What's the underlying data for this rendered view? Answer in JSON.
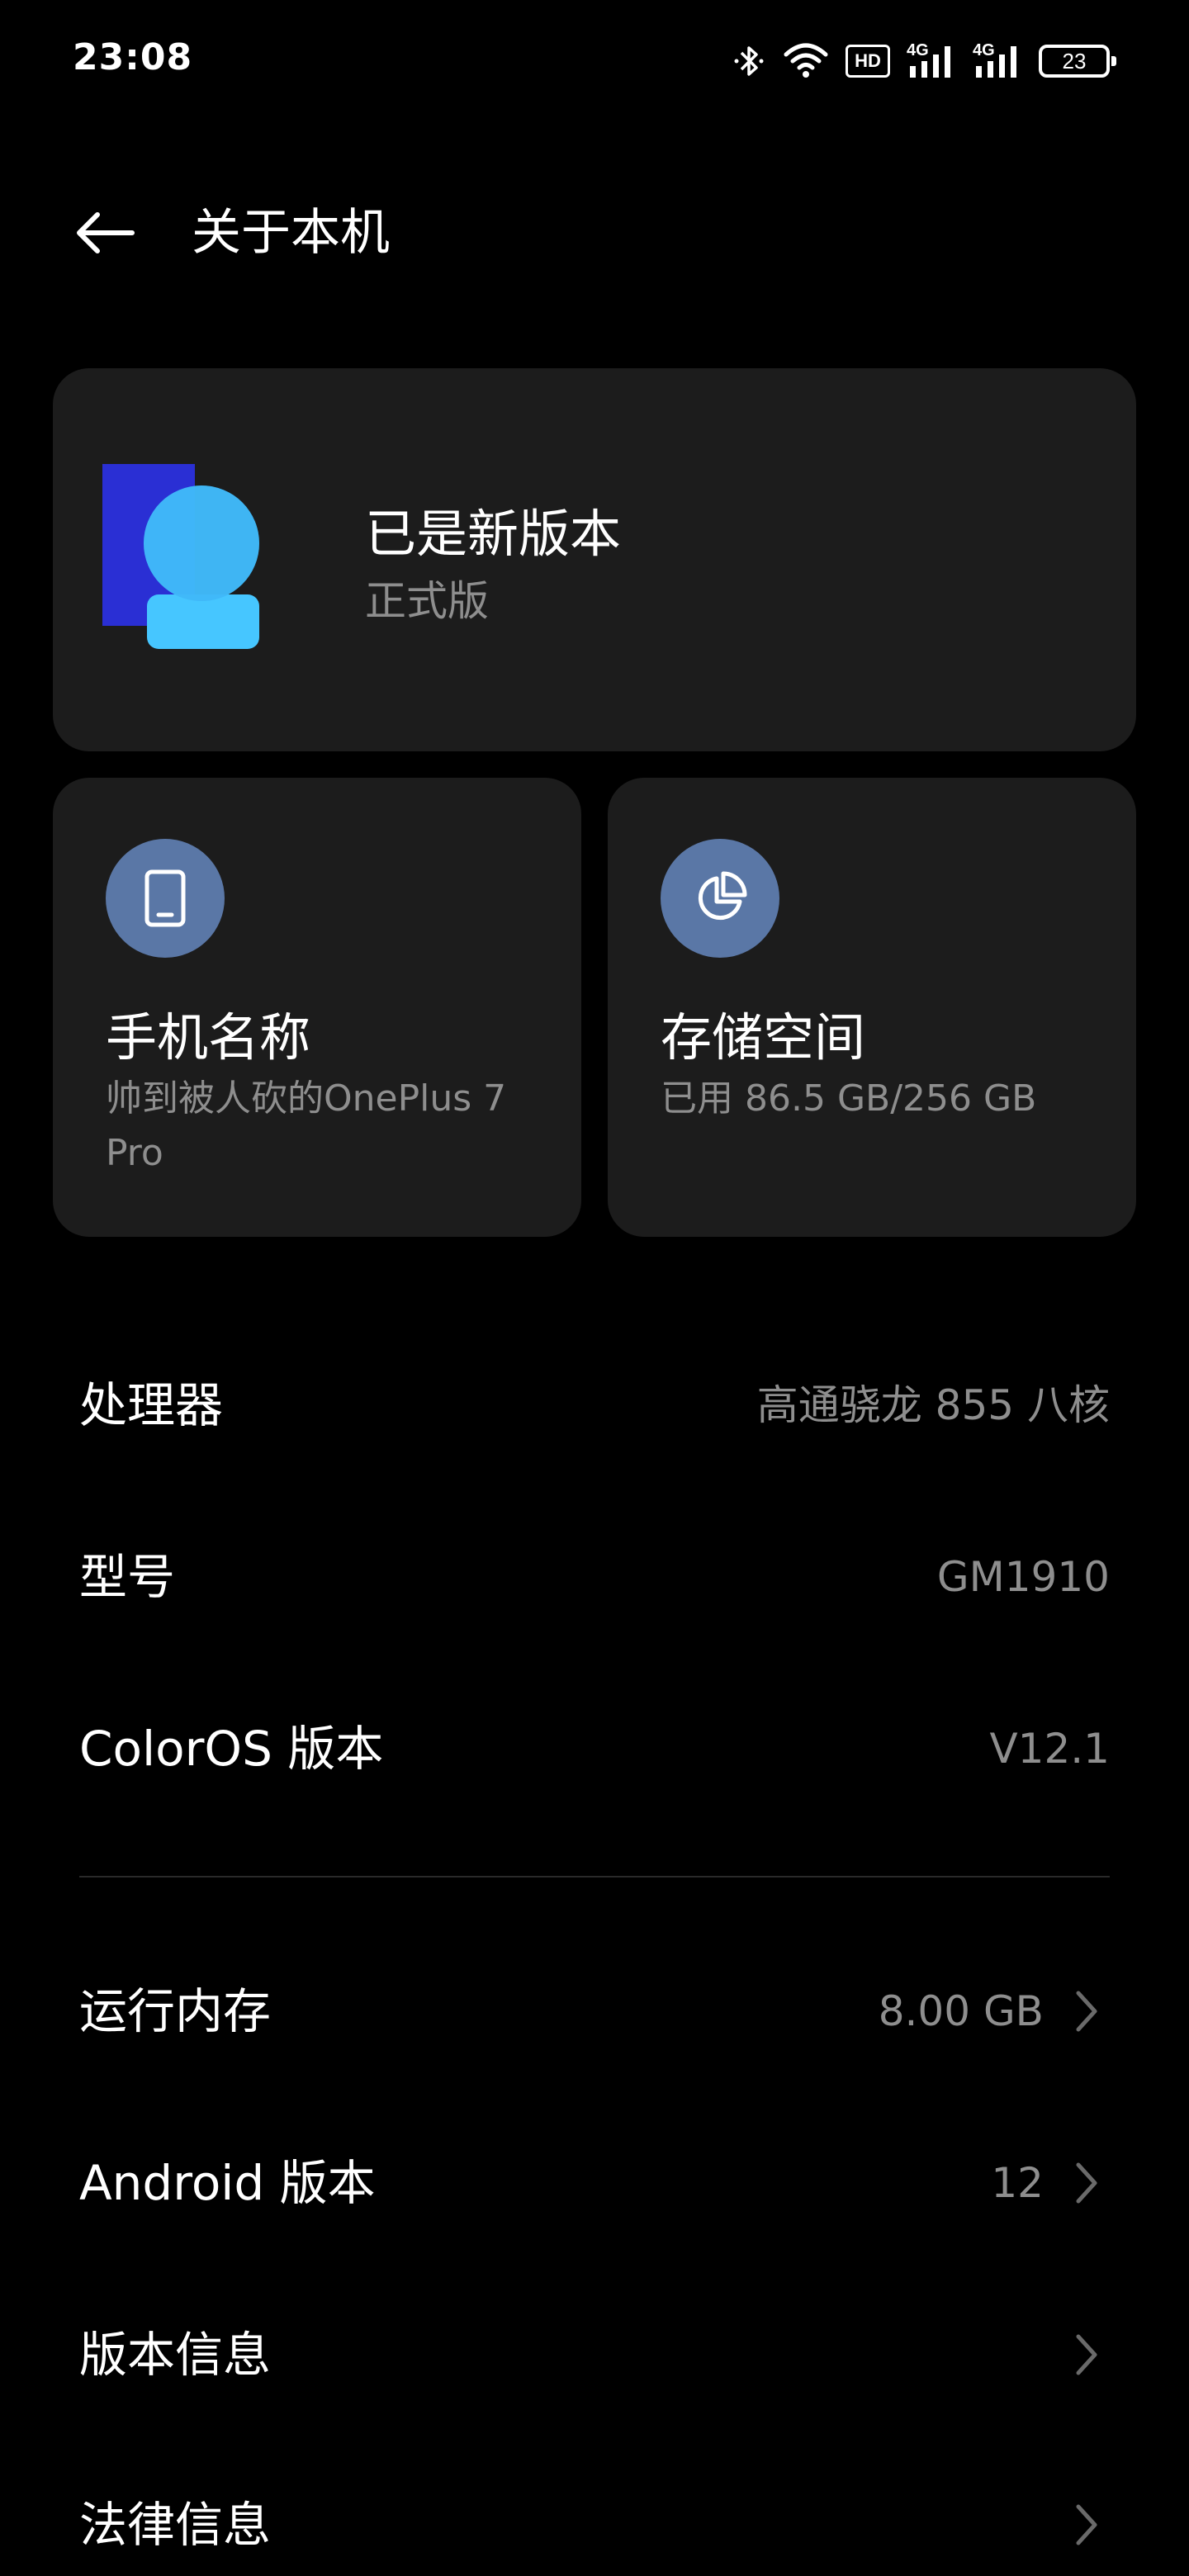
{
  "status_bar": {
    "time": "23:08",
    "icons": [
      "bluetooth-icon",
      "wifi-icon",
      "hd-icon",
      "signal-4g-icon",
      "signal-4g-icon"
    ],
    "hd_label": "HD",
    "network_label": "4G",
    "battery_level": "23"
  },
  "header": {
    "title": "关于本机",
    "back_icon": "back-arrow-icon"
  },
  "update_card": {
    "title": "已是新版本",
    "subtitle": "正式版",
    "logo": "coloros-logo"
  },
  "phone_name_card": {
    "icon": "phone-icon",
    "title": "手机名称",
    "value": "帅到被人砍的OnePlus 7 Pro"
  },
  "storage_card": {
    "icon": "pie-chart-icon",
    "title": "存储空间",
    "value": "已用 86.5 GB/256 GB"
  },
  "info_rows": [
    {
      "label": "处理器",
      "value": "高通骁龙 855 八核",
      "chevron": false
    },
    {
      "label": "型号",
      "value": "GM1910",
      "chevron": false
    },
    {
      "label": "ColorOS 版本",
      "value": "V12.1",
      "chevron": false
    }
  ],
  "detail_rows": [
    {
      "label": "运行内存",
      "value": "8.00 GB",
      "chevron": true
    },
    {
      "label": "Android 版本",
      "value": "12",
      "chevron": true
    },
    {
      "label": "版本信息",
      "value": "",
      "chevron": true
    },
    {
      "label": "法律信息",
      "value": "",
      "chevron": true
    }
  ],
  "colors": {
    "background": "#000000",
    "card": "#1c1c1c",
    "icon_circle": "#5a77a6",
    "secondary_text": "#8e8e8e",
    "logo_dark_blue": "#2a2fd4",
    "logo_light_blue": "#46c6ff"
  }
}
